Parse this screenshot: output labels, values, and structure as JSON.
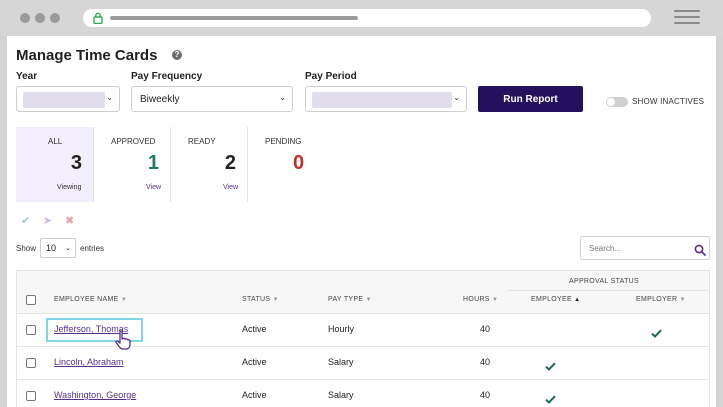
{
  "page": {
    "title": "Manage Time Cards",
    "help_icon": "?"
  },
  "filters": {
    "year_label": "Year",
    "year_value": "",
    "pay_frequency_label": "Pay Frequency",
    "pay_frequency_value": "Biweekly",
    "pay_period_label": "Pay Period",
    "pay_period_value": "",
    "run_report_label": "Run Report",
    "show_inactives_label": "SHOW INACTIVES",
    "show_inactives_on": false
  },
  "summary": [
    {
      "label": "ALL",
      "count": "3",
      "link": "Viewing",
      "color": "#222222"
    },
    {
      "label": "APPROVED",
      "count": "1",
      "link": "View",
      "color": "#1e7b67"
    },
    {
      "label": "READY",
      "count": "2",
      "link": "View",
      "color": "#222222"
    },
    {
      "label": "PENDING",
      "count": "0",
      "link": "",
      "color": "#c0312b"
    }
  ],
  "bulk_actions": [
    {
      "icon": "check-icon",
      "glyph": "✔",
      "color": "#9ccfbf"
    },
    {
      "icon": "cursor-arrow-icon",
      "glyph": "➤",
      "color": "#cdb6e6"
    },
    {
      "icon": "close-icon",
      "glyph": "✖",
      "color": "#e8a0a0"
    }
  ],
  "table_controls": {
    "show_label": "Show",
    "entries_value": "10",
    "entries_label": "entries",
    "search_placeholder": "Search..."
  },
  "table": {
    "group_header": "APPROVAL STATUS",
    "columns": {
      "employee_name": "EMPLOYEE NAME",
      "status": "STATUS",
      "pay_type": "PAY TYPE",
      "hours": "HOURS",
      "employee": "EMPLOYEE",
      "employer": "EMPLOYER"
    },
    "sort_glyph": "▼",
    "sort_active_glyph": "▲",
    "rows": [
      {
        "name": "Jefferson, Thomas",
        "status": "Active",
        "pay_type": "Hourly",
        "hours": "40",
        "employee_approved": false,
        "employer_approved": true
      },
      {
        "name": "Lincoln, Abraham",
        "status": "Active",
        "pay_type": "Salary",
        "hours": "40",
        "employee_approved": true,
        "employer_approved": false
      },
      {
        "name": "Washington, George",
        "status": "Active",
        "pay_type": "Salary",
        "hours": "40",
        "employee_approved": true,
        "employer_approved": false
      }
    ]
  },
  "colors": {
    "accent": "#23115e",
    "link": "#5a2f8c",
    "approved_check": "#1e6b55",
    "highlight": "#7fd6e8"
  }
}
